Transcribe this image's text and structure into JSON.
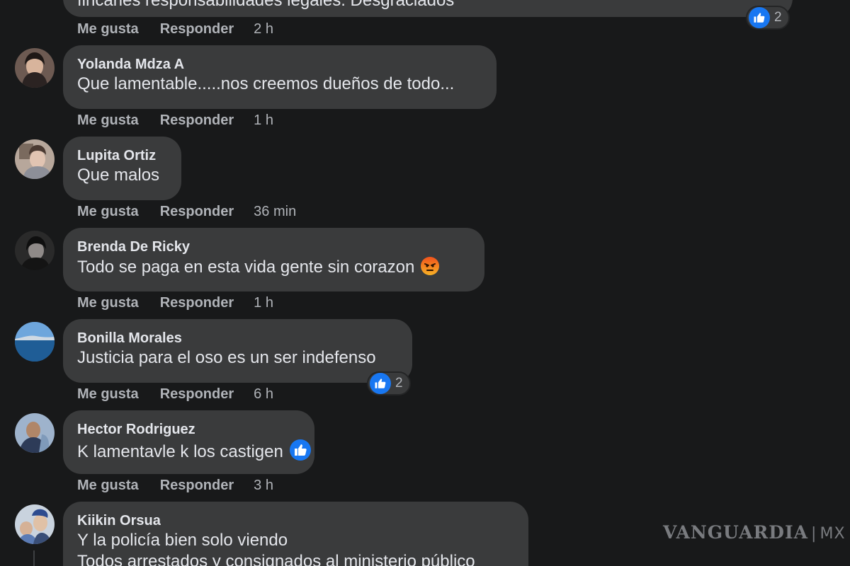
{
  "actions": {
    "like_label": "Me gusta",
    "reply_label": "Responder"
  },
  "comments": [
    {
      "author": "",
      "text": "fincarles responsabilidades legales. Desgraciados",
      "time": "2 h",
      "reaction_count": "2",
      "reaction_icon": "like-icon"
    },
    {
      "author": "Yolanda Mdza A",
      "text": "Que lamentable.....nos creemos dueños de todo...",
      "time": "1 h"
    },
    {
      "author": "Lupita Ortiz",
      "text": "Que malos",
      "time": "36 min"
    },
    {
      "author": "Brenda De Ricky",
      "text": "Todo se paga en esta vida gente sin corazon",
      "time": "1 h",
      "emoji": "angry-face-icon"
    },
    {
      "author": "Bonilla Morales",
      "text": "Justicia para el oso es un ser indefenso",
      "time": "6 h",
      "reaction_count": "2",
      "reaction_icon": "like-icon"
    },
    {
      "author": "Hector Rodriguez",
      "text": "K lamentavle k los castigen",
      "time": "3 h",
      "emoji": "like-icon"
    },
    {
      "author": "Kiikin Orsua",
      "text": "Y la policía bien solo viendo",
      "text_line2": "Todos arrestados y consignados al ministerio público"
    }
  ],
  "watermark": {
    "brand": "VANGUARDIA",
    "suffix": "MX"
  },
  "colors": {
    "background": "#18191a",
    "bubble": "#3a3b3c",
    "primary_text": "#e4e6eb",
    "secondary_text": "#b0b3b8",
    "like_blue": "#1877f2",
    "angry_orange": "#e9710f"
  }
}
